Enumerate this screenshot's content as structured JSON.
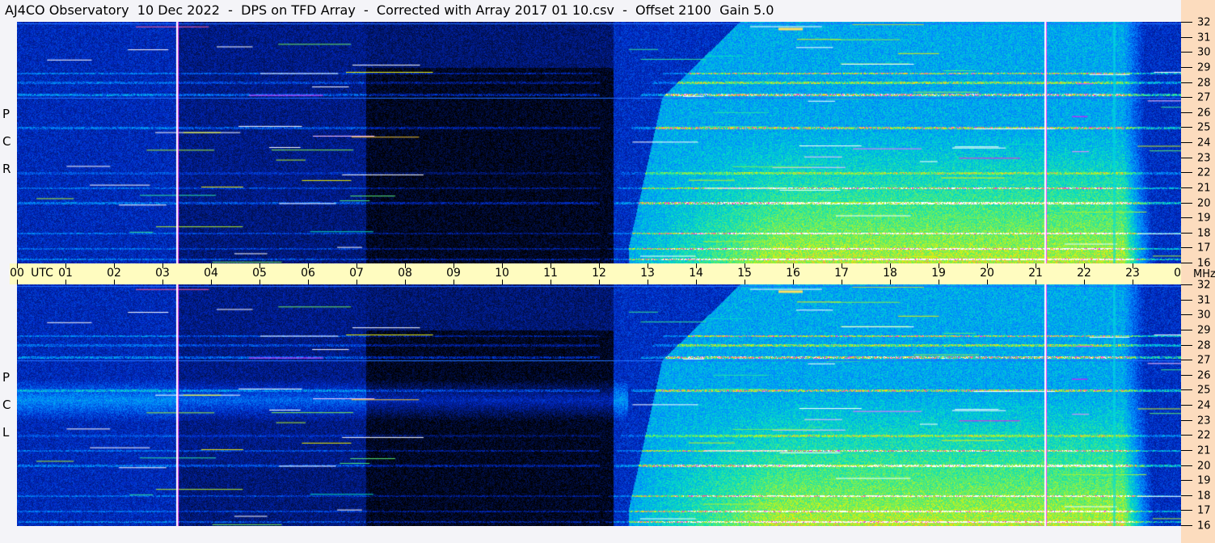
{
  "title": "AJ4CO Observatory  10 Dec 2022  -  DPS on TFD Array  -  Corrected with Array 2017 01 10.csv  -  Offset 2100  Gain 5.0",
  "chart_data": {
    "type": "heatmap",
    "panels": [
      {
        "name": "R C P",
        "label_letters": [
          "P",
          "C",
          "R"
        ]
      },
      {
        "name": "L C P",
        "label_letters": [
          "P",
          "C",
          "L"
        ]
      }
    ],
    "x_axis": {
      "unit_label": "UTC",
      "ticks": [
        "00",
        "01",
        "02",
        "03",
        "04",
        "05",
        "06",
        "07",
        "08",
        "09",
        "10",
        "11",
        "12",
        "13",
        "14",
        "15",
        "16",
        "17",
        "18",
        "19",
        "20",
        "21",
        "22",
        "23",
        "00"
      ],
      "range_hours": [
        0,
        24
      ]
    },
    "y_axis": {
      "unit_label": "MHz",
      "ticks": [
        "32",
        "31",
        "30",
        "29",
        "28",
        "27",
        "26",
        "25",
        "24",
        "23",
        "22",
        "21",
        "20",
        "19",
        "18",
        "17",
        "16"
      ],
      "range": [
        16,
        32
      ]
    },
    "colormap": [
      "#000000",
      "#0028c8",
      "#008cff",
      "#00dcc8",
      "#78f050",
      "#f0f000",
      "#ff00ff",
      "#ffffff"
    ],
    "markers_utc": [
      3.3,
      21.2
    ],
    "emission_window_utc": [
      12.6,
      23.8
    ]
  }
}
